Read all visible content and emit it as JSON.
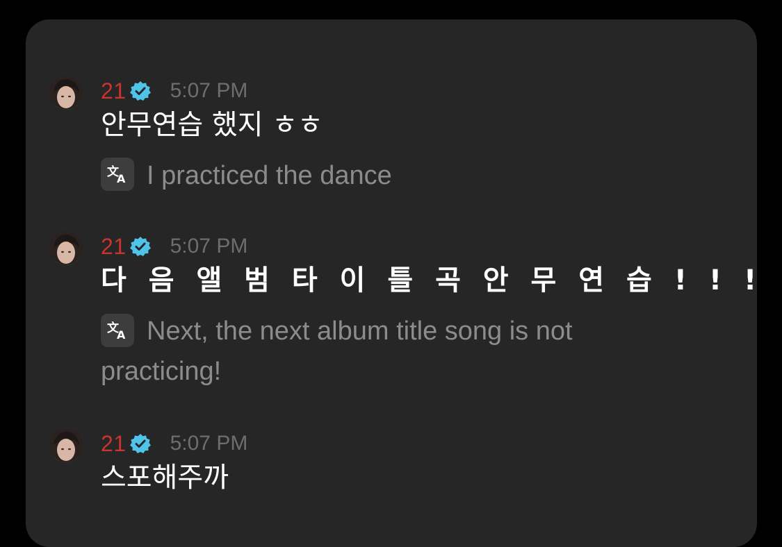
{
  "messages": [
    {
      "username": "21",
      "time": "5:07 PM",
      "text": "안무연습 했지 ㅎㅎ",
      "translation": "I practiced the dance"
    },
    {
      "username": "21",
      "time": "5:07 PM",
      "text": "다 음 앨 범 타 이 틀 곡 안 무 연 습 ! ! !",
      "translation": "Next, the next album title song is not practicing!"
    },
    {
      "username": "21",
      "time": "5:07 PM",
      "text": "스포해주까",
      "translation": ""
    }
  ],
  "colors": {
    "background": "#000000",
    "card": "#262626",
    "username": "#c8352d",
    "verified": "#4fc3e8",
    "timestamp": "#6e6e6e",
    "message_text": "#ffffff",
    "translation_text": "#8c8c8c"
  },
  "icons": {
    "verified": "verified-badge-icon",
    "translate": "translate-icon",
    "avatar": "user-avatar"
  }
}
